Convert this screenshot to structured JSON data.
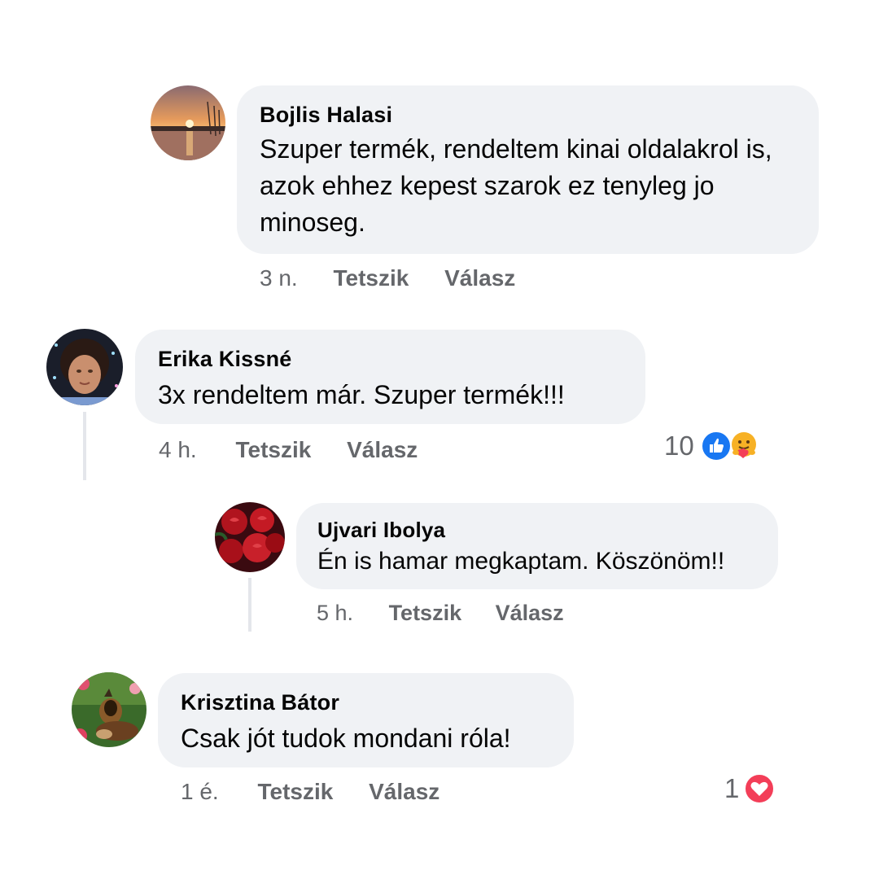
{
  "comments": [
    {
      "author": "Bojlis Halasi",
      "text": "Szuper termék, rendeltem kinai oldalakrol is, azok ehhez kepest szarok ez tenyleg jo minoseg.",
      "time": "3 n.",
      "like_label": "Tetszik",
      "reply_label": "Válasz"
    },
    {
      "author": "Erika Kissné",
      "text": "3x rendeltem már. Szuper termék!!!",
      "time": "4 h.",
      "like_label": "Tetszik",
      "reply_label": "Válasz",
      "reaction_count": "10",
      "reaction_icons": [
        "like-icon",
        "care-icon"
      ]
    },
    {
      "author": "Ujvari Ibolya",
      "text": "Én is hamar megkaptam. Köszönöm!!",
      "time": "5 h.",
      "like_label": "Tetszik",
      "reply_label": "Válasz"
    },
    {
      "author": "Krisztina Bátor",
      "text": "Csak jót tudok mondani róla!",
      "time": "1 é.",
      "like_label": "Tetszik",
      "reply_label": "Válasz",
      "reaction_count": "1",
      "reaction_icons": [
        "love-icon"
      ]
    }
  ],
  "colors": {
    "bubble": "#f0f2f5",
    "meta_text": "#65676b",
    "like_blue": "#1877f2",
    "love_red": "#f33e58",
    "care_yellow": "#f7b125"
  }
}
